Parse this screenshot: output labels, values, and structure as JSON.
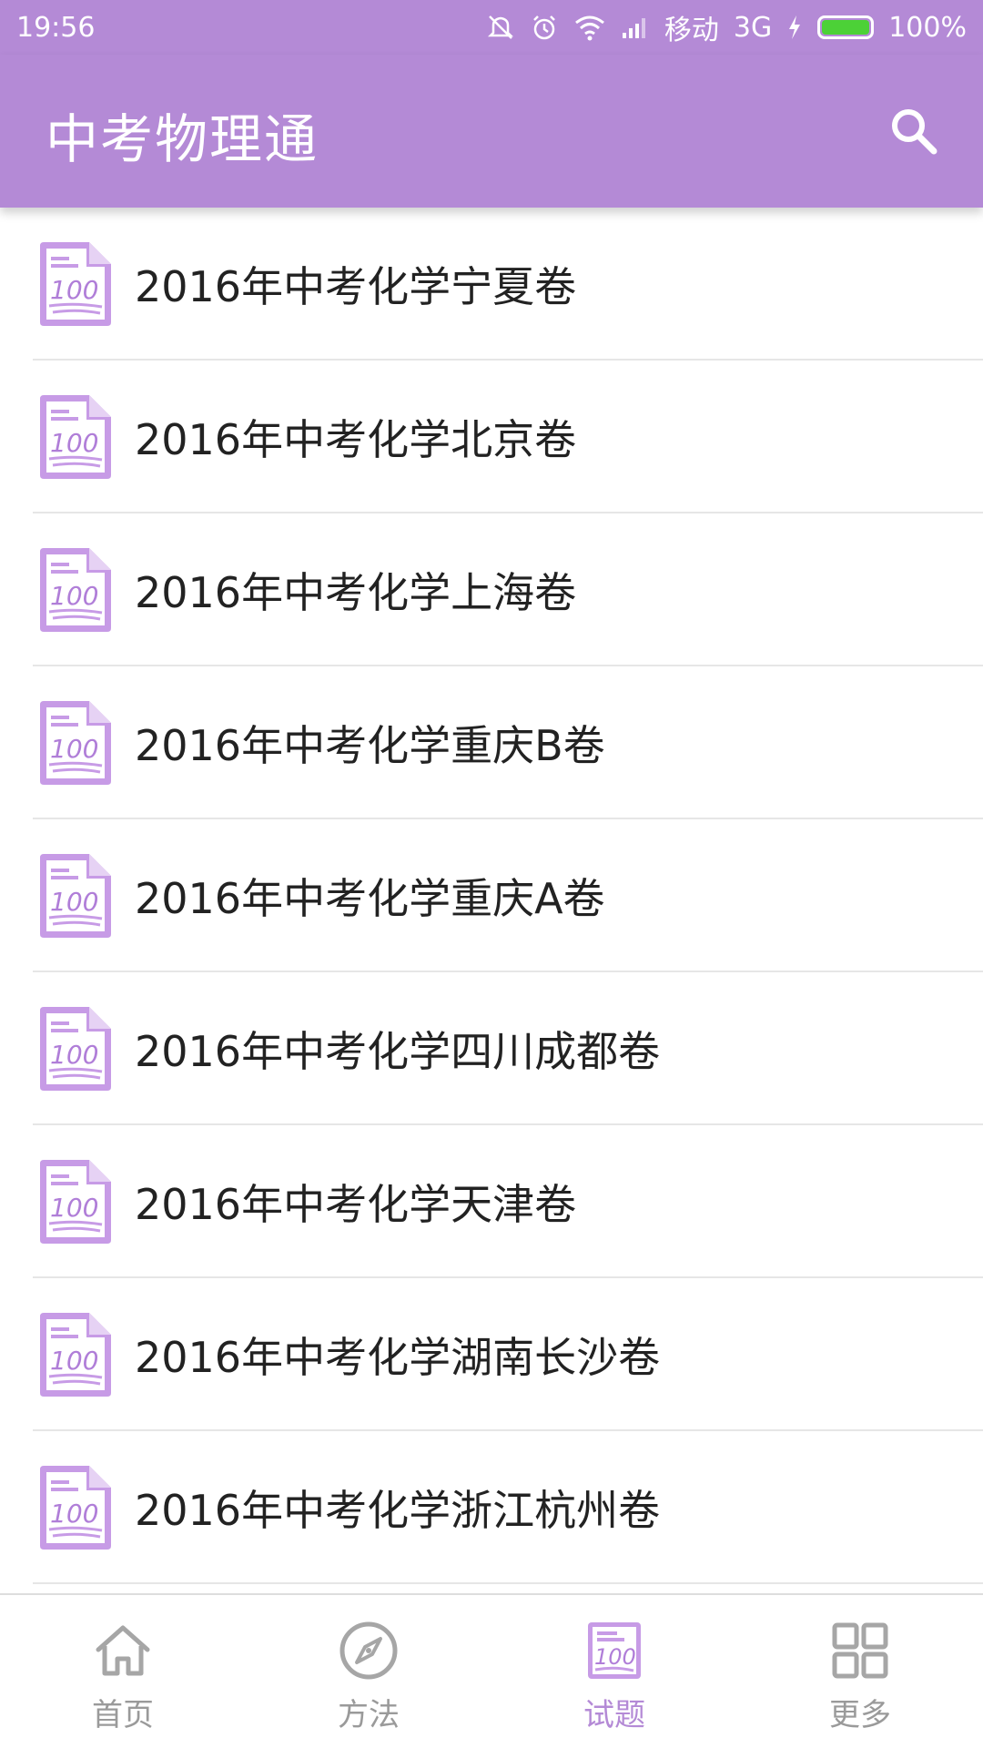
{
  "status_bar": {
    "time": "19:56",
    "carrier": "移动",
    "network": "3G",
    "battery": "100%",
    "icons": [
      "mute-icon",
      "alarm-icon",
      "wifi-icon",
      "signal-icon",
      "charging-icon",
      "battery-icon"
    ]
  },
  "app_bar": {
    "title": "中考物理通",
    "search_icon": "search-icon"
  },
  "colors": {
    "accent": "#b48ad6",
    "text": "#222222",
    "nav_inactive": "#9a9a9a"
  },
  "list": {
    "icon": "exam-paper-icon",
    "items": [
      {
        "label": "2016年中考化学宁夏卷"
      },
      {
        "label": "2016年中考化学北京卷"
      },
      {
        "label": "2016年中考化学上海卷"
      },
      {
        "label": "2016年中考化学重庆B卷"
      },
      {
        "label": "2016年中考化学重庆A卷"
      },
      {
        "label": "2016年中考化学四川成都卷"
      },
      {
        "label": "2016年中考化学天津卷"
      },
      {
        "label": "2016年中考化学湖南长沙卷"
      },
      {
        "label": "2016年中考化学浙江杭州卷"
      }
    ]
  },
  "bottom_nav": {
    "items": [
      {
        "label": "首页",
        "icon": "home-icon",
        "active": false
      },
      {
        "label": "方法",
        "icon": "compass-icon",
        "active": false
      },
      {
        "label": "试题",
        "icon": "exam-paper-icon",
        "active": true
      },
      {
        "label": "更多",
        "icon": "grid-icon",
        "active": false
      }
    ]
  }
}
